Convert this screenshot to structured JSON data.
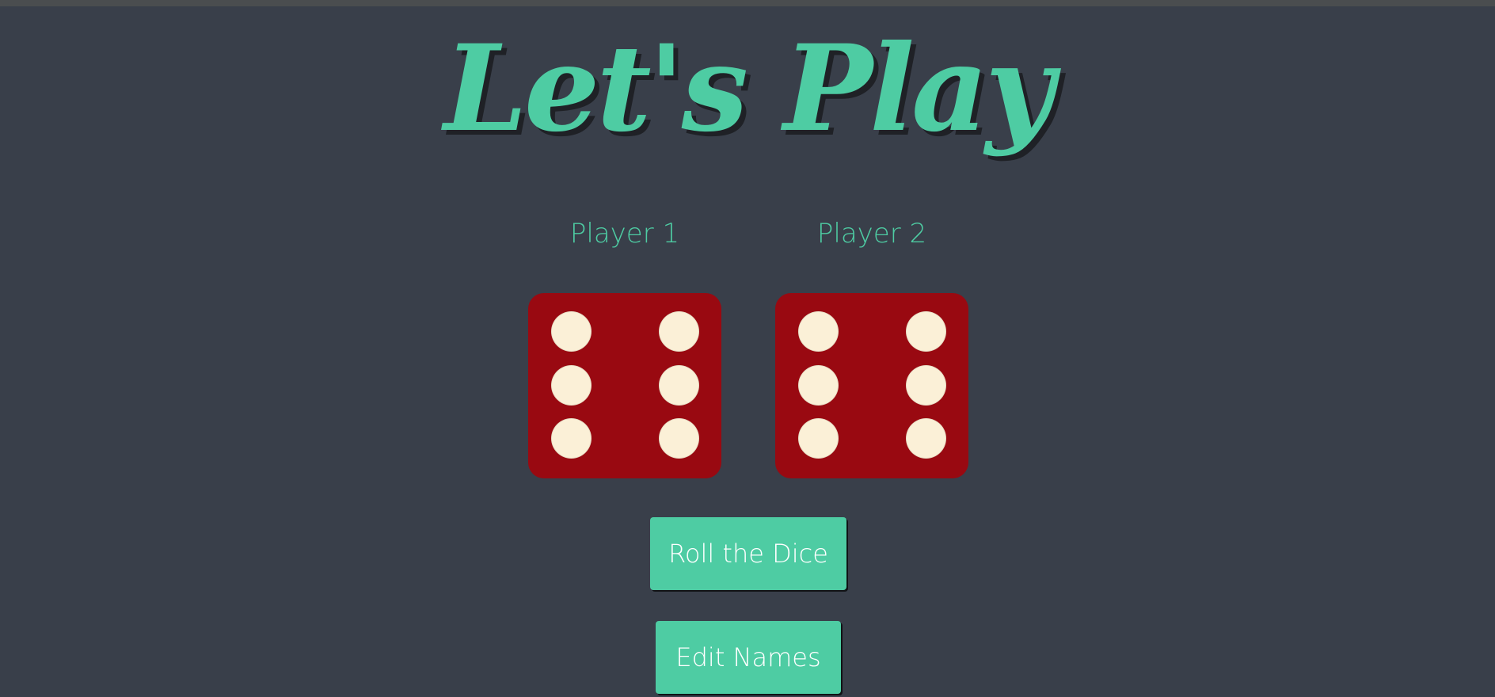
{
  "title": "Let's Play",
  "players": [
    {
      "label": "Player 1",
      "die_value": 6
    },
    {
      "label": "Player 2",
      "die_value": 6
    }
  ],
  "buttons": {
    "roll_label": "Roll the Dice",
    "edit_label": "Edit Names"
  },
  "colors": {
    "background": "#393f4a",
    "accent": "#4ecca3",
    "die_face": "#990911",
    "pip": "#fbf0d7",
    "button_text": "#ffffff"
  }
}
